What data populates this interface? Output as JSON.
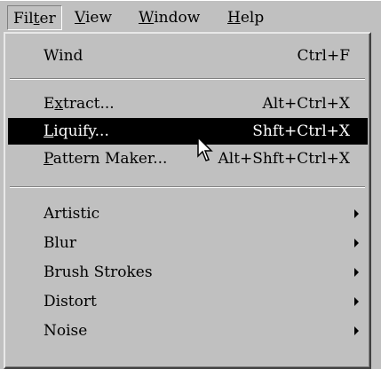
{
  "menubar": {
    "items": [
      {
        "pre": "Fil",
        "ul": "t",
        "post": "er"
      },
      {
        "pre": "",
        "ul": "V",
        "post": "iew"
      },
      {
        "pre": "",
        "ul": "W",
        "post": "indow"
      },
      {
        "pre": "",
        "ul": "H",
        "post": "elp"
      }
    ]
  },
  "menu": {
    "wind": {
      "label": "Wind",
      "shortcut": "Ctrl+F"
    },
    "extract": {
      "pre": "E",
      "ul": "x",
      "post": "tract...",
      "shortcut": "Alt+Ctrl+X"
    },
    "liquify": {
      "pre": "",
      "ul": "L",
      "post": "iquify...",
      "shortcut": "Shft+Ctrl+X"
    },
    "pattern_maker": {
      "pre": "",
      "ul": "P",
      "post": "attern Maker...",
      "shortcut": "Alt+Shft+Ctrl+X"
    },
    "submenus": [
      "Artistic",
      "Blur",
      "Brush Strokes",
      "Distort",
      "Noise"
    ]
  }
}
